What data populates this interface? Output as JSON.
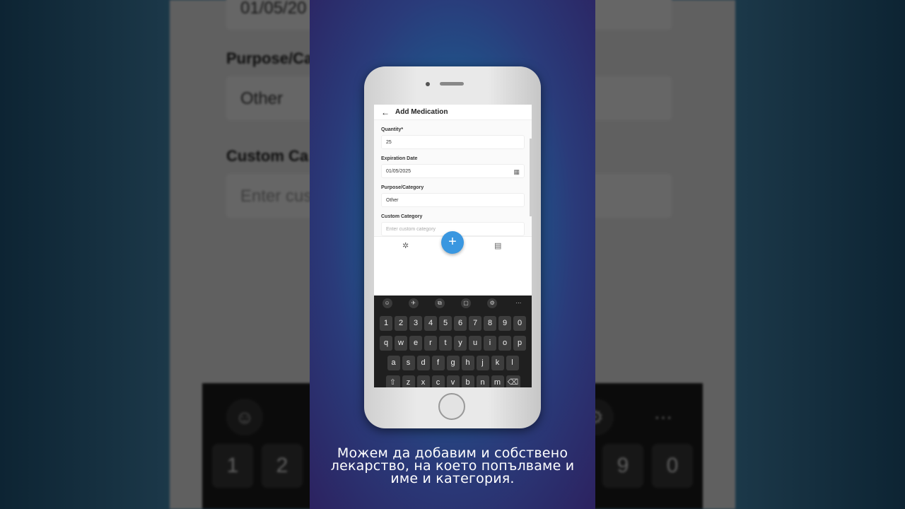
{
  "app": {
    "title": "Add Medication",
    "back_icon": "arrow-left-icon"
  },
  "form": {
    "quantity_label": "Quantity*",
    "quantity_value": "25",
    "expiration_label": "Expiration Date",
    "expiration_value": "01/05/2025",
    "purpose_label": "Purpose/Category",
    "purpose_value": "Other",
    "custom_label": "Custom Category",
    "custom_placeholder": "Enter custom category"
  },
  "bottom_nav": {
    "fab_label": "+",
    "left_icon": "settings-icon",
    "right_icon": "calendar-icon"
  },
  "keyboard": {
    "toolbar": [
      "☺",
      "✈",
      "⧉",
      "▢",
      "⚙",
      "⋯"
    ],
    "numbers": [
      "1",
      "2",
      "3",
      "4",
      "5",
      "6",
      "7",
      "8",
      "9",
      "0"
    ],
    "row1": [
      "q",
      "w",
      "e",
      "r",
      "t",
      "y",
      "u",
      "i",
      "o",
      "p"
    ],
    "row2": [
      "a",
      "s",
      "d",
      "f",
      "g",
      "h",
      "j",
      "k",
      "l"
    ],
    "row3": [
      "⇧",
      "z",
      "x",
      "c",
      "v",
      "b",
      "n",
      "m",
      "⌫"
    ]
  },
  "background": {
    "date_value": "01/05/20",
    "purpose_label": "Purpose/Ca",
    "purpose_value": "Other",
    "custom_label": "Custom Ca",
    "custom_placeholder": "Enter cus",
    "keys": [
      "1",
      "2",
      "9",
      "0"
    ],
    "more": "⋯"
  },
  "caption": {
    "line1": "Можем да добавим и собствено",
    "line2": "лекарство, на което попълваме и",
    "line3": "име и категория."
  }
}
